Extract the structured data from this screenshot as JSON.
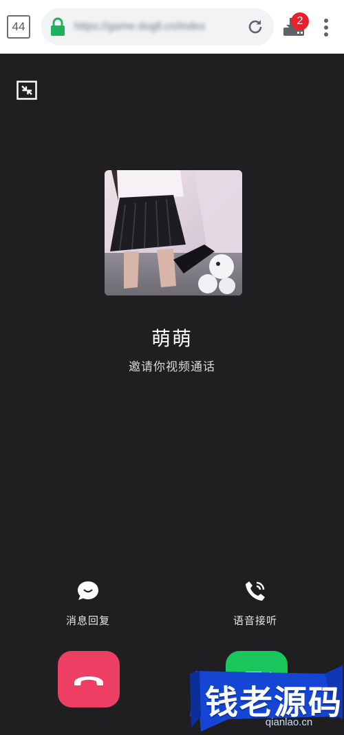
{
  "browser": {
    "tab_count": "44",
    "url": "https://game.dogll.cn/index",
    "download_badge": "2",
    "icons": {
      "lock": "lock-icon",
      "reload": "reload-icon",
      "download": "download-icon",
      "menu": "more-vert-icon"
    }
  },
  "call": {
    "caller_name": "萌萌",
    "status": "邀请你视频通话",
    "actions": {
      "message_reply": "消息回复",
      "voice_answer": "语音接听"
    },
    "icons": {
      "minimize": "minimize-icon",
      "message": "chat-bubble-icon",
      "voice": "phone-call-icon",
      "hangup": "hangup-icon",
      "accept": "video-accept-icon"
    }
  },
  "watermark": {
    "title": "钱老源码",
    "domain": "qianlao.cn"
  },
  "colors": {
    "background": "#1f1f21",
    "hangup": "#ec3f63",
    "accept": "#19c65b",
    "badge": "#e8222d",
    "lock": "#1eb35a",
    "watermark": "#1546d3"
  }
}
